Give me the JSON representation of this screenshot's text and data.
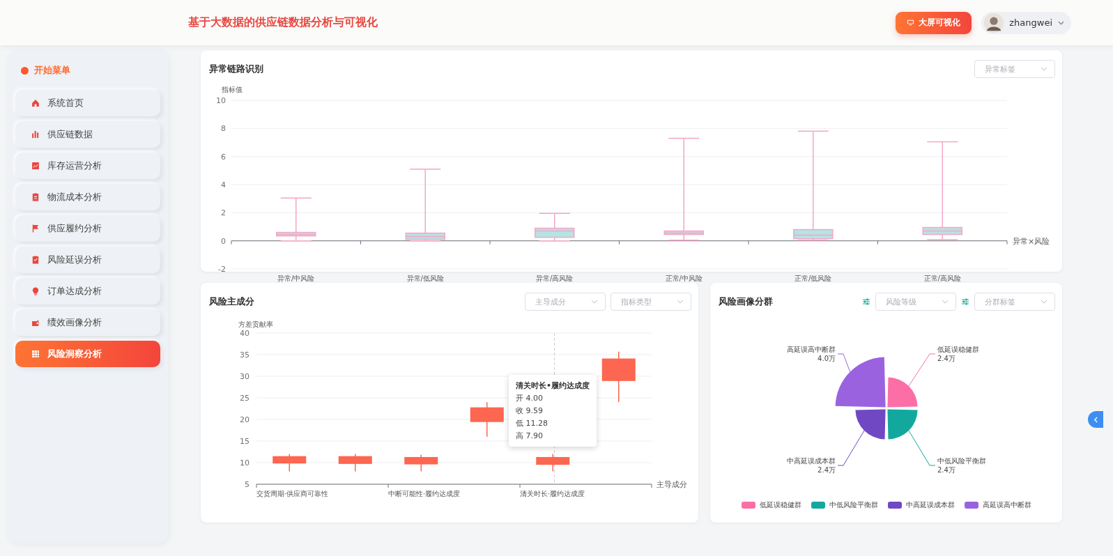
{
  "header": {
    "title": "基于大数据的供应链数据分析与可视化",
    "big_screen_button": "大屏可视化",
    "user": "zhangwei"
  },
  "sidebar": {
    "title": "开始菜单",
    "items": [
      {
        "label": "系统首页",
        "selected": false
      },
      {
        "label": "供应链数据",
        "selected": false
      },
      {
        "label": "库存运营分析",
        "selected": false
      },
      {
        "label": "物流成本分析",
        "selected": false
      },
      {
        "label": "供应履约分析",
        "selected": false
      },
      {
        "label": "风险延误分析",
        "selected": false
      },
      {
        "label": "订单达成分析",
        "selected": false
      },
      {
        "label": "绩效画像分析",
        "selected": false
      },
      {
        "label": "风险洞察分析",
        "selected": true
      }
    ]
  },
  "anomaly_card": {
    "title": "异常链路识别",
    "filters": [
      {
        "placeholder": "异常标签"
      }
    ],
    "chart": {
      "kind": "box_plot",
      "y_axis_title": "指标值",
      "x_axis_title": "异常×风险",
      "y_tick_labels": [
        "10",
        "8",
        "6",
        "4",
        "2",
        "0",
        "-2"
      ],
      "categories": [
        "异常/中风险",
        "异常/低风险",
        "异常/高风险",
        "正常/中风险",
        "正常/低风险",
        "正常/高风险"
      ]
    }
  },
  "pca_card": {
    "title": "风险主成分",
    "filters": [
      {
        "placeholder": "主导成分"
      },
      {
        "placeholder": "指标类型"
      }
    ],
    "chart": {
      "kind": "candlestick",
      "y_axis_title": "方差贡献率",
      "x_axis_title": "主导成分",
      "y_tick_labels": [
        "40",
        "35",
        "30",
        "25",
        "20",
        "15",
        "10",
        "5"
      ],
      "x_labels": [
        "交货周期·供应商可靠性",
        "中断可能性·履约达成度",
        "清关时长·履约达成度"
      ]
    },
    "tooltip": {
      "title": "清关时长•履约达成度",
      "lines": [
        "开 4.00",
        "收 9.59",
        "低 11.28",
        "高 7.90"
      ]
    }
  },
  "cluster_card": {
    "title": "风险画像分群",
    "filters": [
      {
        "placeholder": "风险等级"
      },
      {
        "placeholder": "分群标签"
      }
    ],
    "slices": [
      {
        "label": "高延误高中断群",
        "value": "4.0万",
        "color": "#9b62e0"
      },
      {
        "label": "低延误稳健群",
        "value": "2.4万",
        "color": "#fb6fa6"
      },
      {
        "label": "中高延误成本群",
        "value": "2.4万",
        "color": "#7048c4"
      },
      {
        "label": "中低风险平衡群",
        "value": "2.4万",
        "color": "#13a89e"
      }
    ],
    "legend": [
      {
        "label": "低延误稳健群",
        "color": "#fb6fa6"
      },
      {
        "label": "中低风险平衡群",
        "color": "#13a89e"
      },
      {
        "label": "中高延误成本群",
        "color": "#7048c4"
      },
      {
        "label": "高延误高中断群",
        "color": "#9b62e0"
      }
    ]
  }
}
